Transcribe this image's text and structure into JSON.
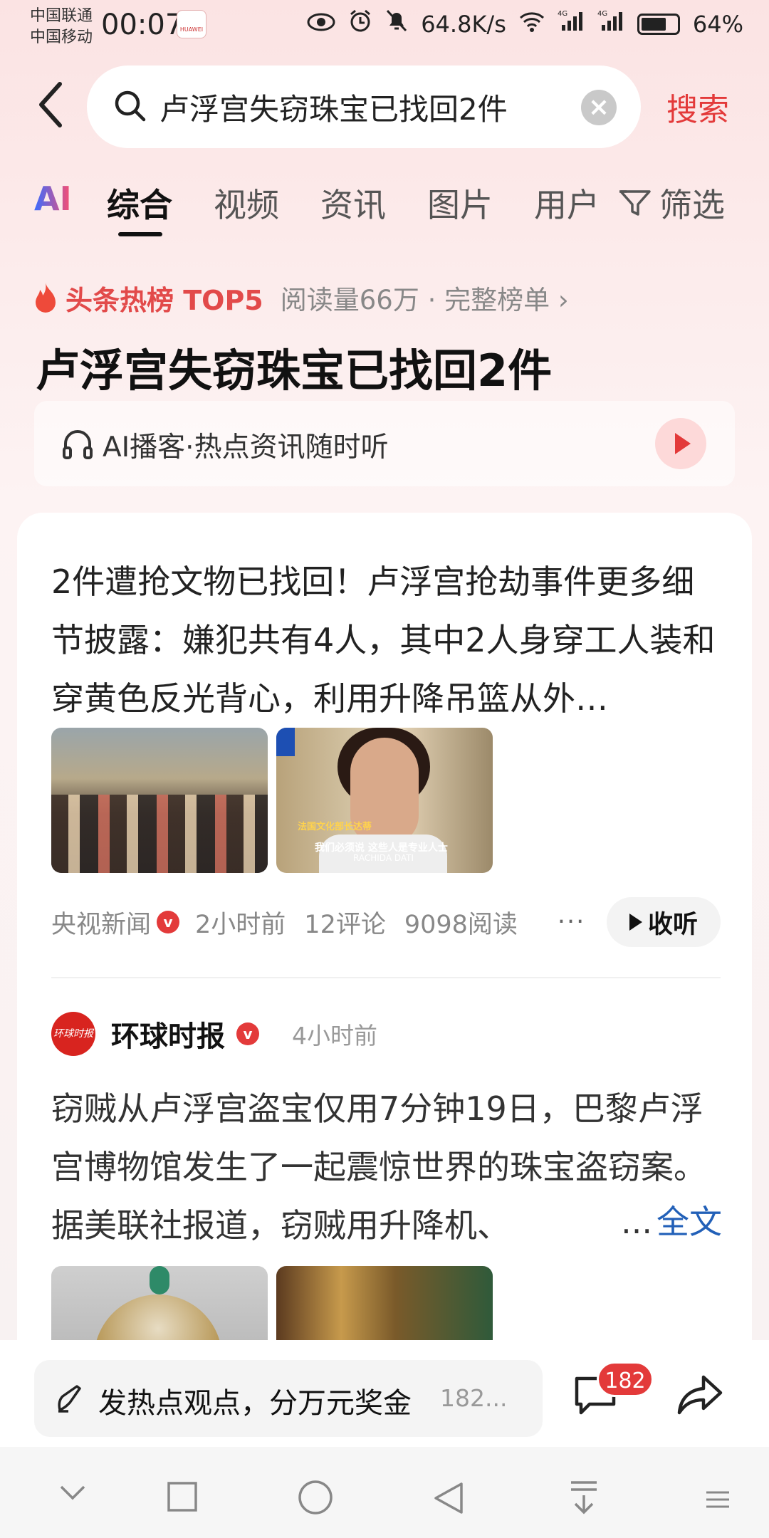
{
  "status_bar": {
    "carrier1": "中国联通",
    "carrier2": "中国移动",
    "time": "00:07",
    "app_badge": "HUAWEI",
    "net_speed": "64.8K/s",
    "battery": "64%"
  },
  "search": {
    "query": "卢浮宫失窃珠宝已找回2件",
    "button": "搜索"
  },
  "tabs": {
    "ai": "AI",
    "items": [
      "综合",
      "视频",
      "资讯",
      "图片",
      "用户"
    ],
    "filter": "筛选"
  },
  "hot": {
    "label": "头条热榜 TOP5",
    "meta": "阅读量66万 · 完整榜单 ›",
    "headline": "卢浮宫失窃珠宝已找回2件"
  },
  "podcast": {
    "text": "AI播客·热点资讯随时听"
  },
  "article1": {
    "title": "2件遭抢文物已找回！卢浮宫抢劫事件更多细节披露：嫌犯共有4人，其中2人身穿工人装和穿黄色反光背心，利用升降吊篮从外…",
    "thumb2_caption1": "法国文化部长达蒂",
    "thumb2_caption2": "我们必须说 这些人是专业人士",
    "thumb2_caption3": "RACHIDA DATI",
    "source": "央视新闻",
    "time": "2小时前",
    "comments": "12评论",
    "reads": "9098阅读",
    "listen": "收听"
  },
  "article2": {
    "source": "环球时报",
    "logo_text": "环球时报",
    "time": "4小时前",
    "body": "窃贼从卢浮宫盗宝仅用7分钟19日，巴黎卢浮宫博物馆发生了一起震惊世界的珠宝盗窃案。据美联社报道，窃贼用升降机、",
    "ellipsis": "...",
    "full_text": "全文"
  },
  "bottom_bar": {
    "placeholder": "发热点观点，分万元奖金",
    "count": "182...",
    "comment_badge": "182"
  },
  "icons": {
    "back": "back-arrow-icon",
    "search": "search-icon",
    "clear": "clear-icon",
    "filter": "filter-icon",
    "flame": "flame-icon",
    "headphones": "headphones-icon",
    "play": "play-icon",
    "verified": "verified-icon",
    "more": "more-icon",
    "pen": "pen-icon",
    "comment": "comment-icon",
    "share": "share-icon"
  },
  "colors": {
    "accent": "#e33a3a",
    "link": "#2260b8"
  }
}
